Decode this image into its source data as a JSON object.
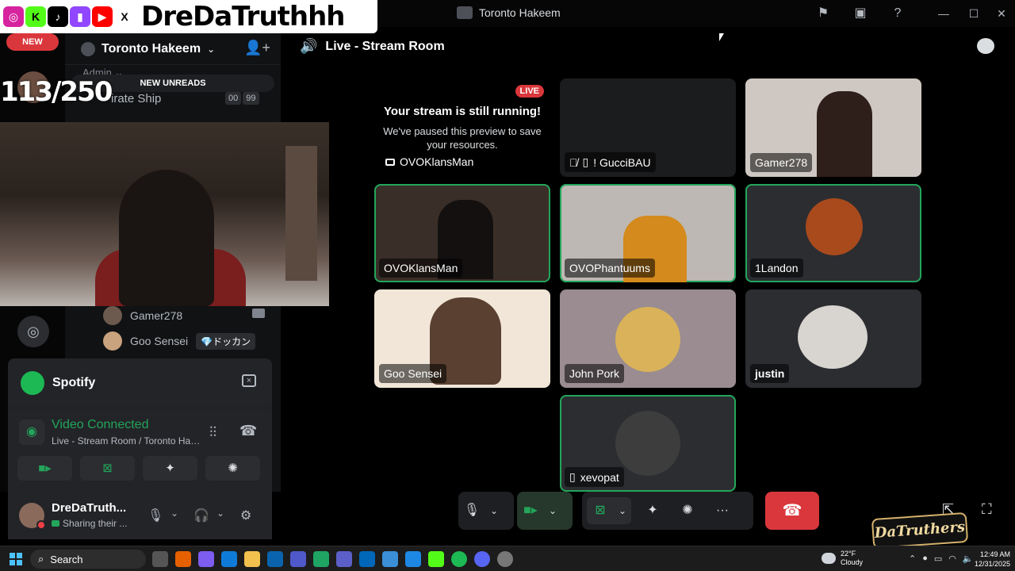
{
  "window": {
    "title": "Toronto Hakeem"
  },
  "overlay": {
    "handle": "DreDaTruthhh",
    "social_icons": [
      "instagram-icon",
      "kick-icon",
      "tiktok-icon",
      "twitch-icon",
      "youtube-icon",
      "x-icon"
    ],
    "counter": "113/250",
    "new_badge": "NEW"
  },
  "server": {
    "name": "Toronto Hakeem",
    "category": "Admin",
    "new_unreads": "NEW UNREADS",
    "channel_partial": "irate Ship",
    "channel_badges": [
      "00",
      "99"
    ]
  },
  "sidebar_members": [
    {
      "name": "Gamer278"
    },
    {
      "name": "Goo Sensei",
      "tag": "💎ドッカン"
    }
  ],
  "spotify": {
    "name": "Spotify"
  },
  "voice_panel": {
    "status": "Video Connected",
    "channel_path": "Live - Stream Room / Toronto Hakeem"
  },
  "user": {
    "name": "DreDaTruth...",
    "status": "Sharing their ..."
  },
  "channel": {
    "title": "Live - Stream Room"
  },
  "stream_notice": {
    "live_badge": "LIVE",
    "heading": "Your stream is still running!",
    "body": "We've paused this preview to save your resources.",
    "streamer": "OVOKlansMan"
  },
  "tiles": [
    {
      "name": "! GucciBAU"
    },
    {
      "name": "Gamer278"
    },
    {
      "name": "OVOKlansMan"
    },
    {
      "name": "OVOPhantuums"
    },
    {
      "name": "1Landon"
    },
    {
      "name": "Goo Sensei"
    },
    {
      "name": "John Pork"
    },
    {
      "name": "justin"
    },
    {
      "name": "xevopat"
    }
  ],
  "watermark": "DaTruthers",
  "taskbar": {
    "search": "Search",
    "weather_temp": "22°F",
    "weather_desc": "Cloudy",
    "time": "12:49 AM",
    "date": "12/31/2025"
  },
  "colors": {
    "accent_green": "#23a55a",
    "danger": "#da373c",
    "bg": "#000000"
  }
}
